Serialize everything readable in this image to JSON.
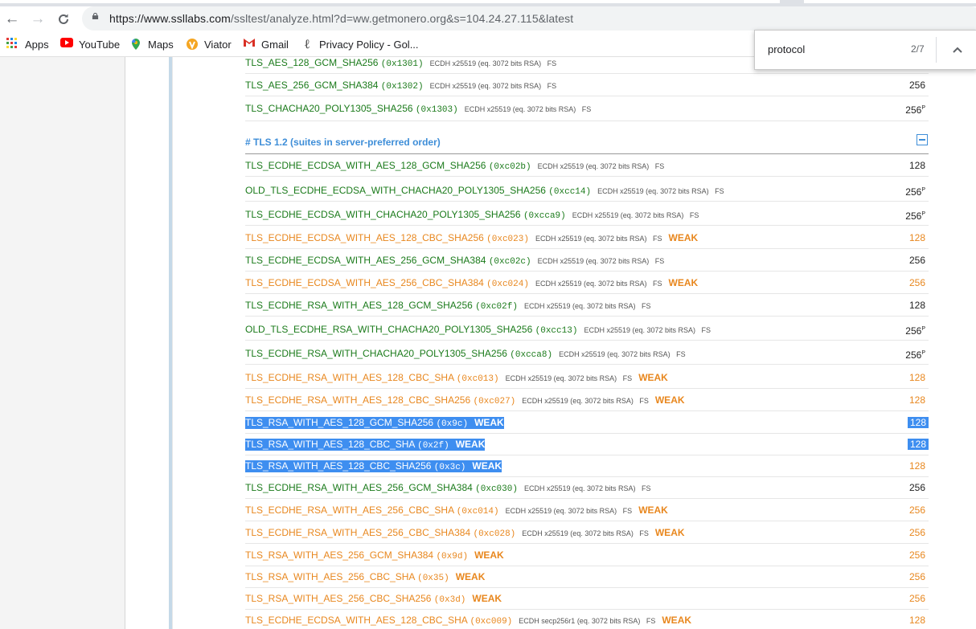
{
  "browser": {
    "url_host": "https://www.ssllabs.com",
    "url_path": "/ssltest/analyze.html?d=ww.getmonero.org&s=104.24.27.115&latest",
    "bookmarks": [
      "Apps",
      "YouTube",
      "Maps",
      "Viator",
      "Gmail",
      "Privacy Policy - Gol..."
    ]
  },
  "find": {
    "query": "protocol",
    "count": "2/7"
  },
  "section": {
    "title": "# TLS 1.2 (suites in server-preferred order)"
  },
  "rows": [
    {
      "name": "TLS_AES_128_GCM_SHA256",
      "code": "(0x1301)",
      "ex": "ECDH x25519 (eq. 3072 bits RSA)   FS",
      "weak": "",
      "bits": "",
      "sup": "",
      "color": "green"
    },
    {
      "name": "TLS_AES_256_GCM_SHA384",
      "code": "(0x1302)",
      "ex": "ECDH x25519 (eq. 3072 bits RSA)   FS",
      "weak": "",
      "bits": "256",
      "sup": "",
      "color": "green"
    },
    {
      "name": "TLS_CHACHA20_POLY1305_SHA256",
      "code": "(0x1303)",
      "ex": "ECDH x25519 (eq. 3072 bits RSA)   FS",
      "weak": "",
      "bits": "256",
      "sup": "P",
      "color": "green"
    },
    {
      "name": "TLS_ECDHE_ECDSA_WITH_AES_128_GCM_SHA256",
      "code": "(0xc02b)",
      "ex": "ECDH x25519 (eq. 3072 bits RSA)   FS",
      "weak": "",
      "bits": "128",
      "sup": "",
      "color": "green"
    },
    {
      "name": "OLD_TLS_ECDHE_ECDSA_WITH_CHACHA20_POLY1305_SHA256",
      "code": "(0xcc14)",
      "ex": "ECDH x25519 (eq. 3072 bits RSA)   FS",
      "weak": "",
      "bits": "256",
      "sup": "P",
      "color": "green"
    },
    {
      "name": "TLS_ECDHE_ECDSA_WITH_CHACHA20_POLY1305_SHA256",
      "code": "(0xcca9)",
      "ex": "ECDH x25519 (eq. 3072 bits RSA)   FS",
      "weak": "",
      "bits": "256",
      "sup": "P",
      "color": "green"
    },
    {
      "name": "TLS_ECDHE_ECDSA_WITH_AES_128_CBC_SHA256",
      "code": "(0xc023)",
      "ex": "ECDH x25519 (eq. 3072 bits RSA)   FS",
      "weak": "WEAK",
      "bits": "128",
      "sup": "",
      "color": "orange"
    },
    {
      "name": "TLS_ECDHE_ECDSA_WITH_AES_256_GCM_SHA384",
      "code": "(0xc02c)",
      "ex": "ECDH x25519 (eq. 3072 bits RSA)   FS",
      "weak": "",
      "bits": "256",
      "sup": "",
      "color": "green"
    },
    {
      "name": "TLS_ECDHE_ECDSA_WITH_AES_256_CBC_SHA384",
      "code": "(0xc024)",
      "ex": "ECDH x25519 (eq. 3072 bits RSA)   FS",
      "weak": "WEAK",
      "bits": "256",
      "sup": "",
      "color": "orange"
    },
    {
      "name": "TLS_ECDHE_RSA_WITH_AES_128_GCM_SHA256",
      "code": "(0xc02f)",
      "ex": "ECDH x25519 (eq. 3072 bits RSA)   FS",
      "weak": "",
      "bits": "128",
      "sup": "",
      "color": "green"
    },
    {
      "name": "OLD_TLS_ECDHE_RSA_WITH_CHACHA20_POLY1305_SHA256",
      "code": "(0xcc13)",
      "ex": "ECDH x25519 (eq. 3072 bits RSA)   FS",
      "weak": "",
      "bits": "256",
      "sup": "P",
      "color": "green"
    },
    {
      "name": "TLS_ECDHE_RSA_WITH_CHACHA20_POLY1305_SHA256",
      "code": "(0xcca8)",
      "ex": "ECDH x25519 (eq. 3072 bits RSA)   FS",
      "weak": "",
      "bits": "256",
      "sup": "P",
      "color": "green"
    },
    {
      "name": "TLS_ECDHE_RSA_WITH_AES_128_CBC_SHA",
      "code": "(0xc013)",
      "ex": "ECDH x25519 (eq. 3072 bits RSA)   FS",
      "weak": "WEAK",
      "bits": "128",
      "sup": "",
      "color": "orange"
    },
    {
      "name": "TLS_ECDHE_RSA_WITH_AES_128_CBC_SHA256",
      "code": "(0xc027)",
      "ex": "ECDH x25519 (eq. 3072 bits RSA)   FS",
      "weak": "WEAK",
      "bits": "128",
      "sup": "",
      "color": "orange"
    },
    {
      "name": "TLS_RSA_WITH_AES_128_GCM_SHA256",
      "code": "(0x9c)",
      "ex": "",
      "weak": "WEAK",
      "bits": "128",
      "sup": "",
      "color": "orange",
      "selected": true
    },
    {
      "name": "TLS_RSA_WITH_AES_128_CBC_SHA",
      "code": "(0x2f)",
      "ex": "",
      "weak": "WEAK",
      "bits": "128",
      "sup": "",
      "color": "orange",
      "selected": true
    },
    {
      "name": "TLS_RSA_WITH_AES_128_CBC_SHA256",
      "code": "(0x3c)",
      "ex": "",
      "weak": "WEAK",
      "bits": "128",
      "sup": "",
      "color": "orange",
      "selected": true,
      "bits_unselected": true
    },
    {
      "name": "TLS_ECDHE_RSA_WITH_AES_256_GCM_SHA384",
      "code": "(0xc030)",
      "ex": "ECDH x25519 (eq. 3072 bits RSA)   FS",
      "weak": "",
      "bits": "256",
      "sup": "",
      "color": "green"
    },
    {
      "name": "TLS_ECDHE_RSA_WITH_AES_256_CBC_SHA",
      "code": "(0xc014)",
      "ex": "ECDH x25519 (eq. 3072 bits RSA)   FS",
      "weak": "WEAK",
      "bits": "256",
      "sup": "",
      "color": "orange"
    },
    {
      "name": "TLS_ECDHE_RSA_WITH_AES_256_CBC_SHA384",
      "code": "(0xc028)",
      "ex": "ECDH x25519 (eq. 3072 bits RSA)   FS",
      "weak": "WEAK",
      "bits": "256",
      "sup": "",
      "color": "orange"
    },
    {
      "name": "TLS_RSA_WITH_AES_256_GCM_SHA384",
      "code": "(0x9d)",
      "ex": "",
      "weak": "WEAK",
      "bits": "256",
      "sup": "",
      "color": "orange"
    },
    {
      "name": "TLS_RSA_WITH_AES_256_CBC_SHA",
      "code": "(0x35)",
      "ex": "",
      "weak": "WEAK",
      "bits": "256",
      "sup": "",
      "color": "orange"
    },
    {
      "name": "TLS_RSA_WITH_AES_256_CBC_SHA256",
      "code": "(0x3d)",
      "ex": "",
      "weak": "WEAK",
      "bits": "256",
      "sup": "",
      "color": "orange"
    },
    {
      "name": "TLS_ECDHE_ECDSA_WITH_AES_128_CBC_SHA",
      "code": "(0xc009)",
      "ex": "ECDH secp256r1 (eq. 3072 bits RSA)   FS",
      "weak": "WEAK",
      "bits": "128",
      "sup": "",
      "color": "orange"
    }
  ]
}
